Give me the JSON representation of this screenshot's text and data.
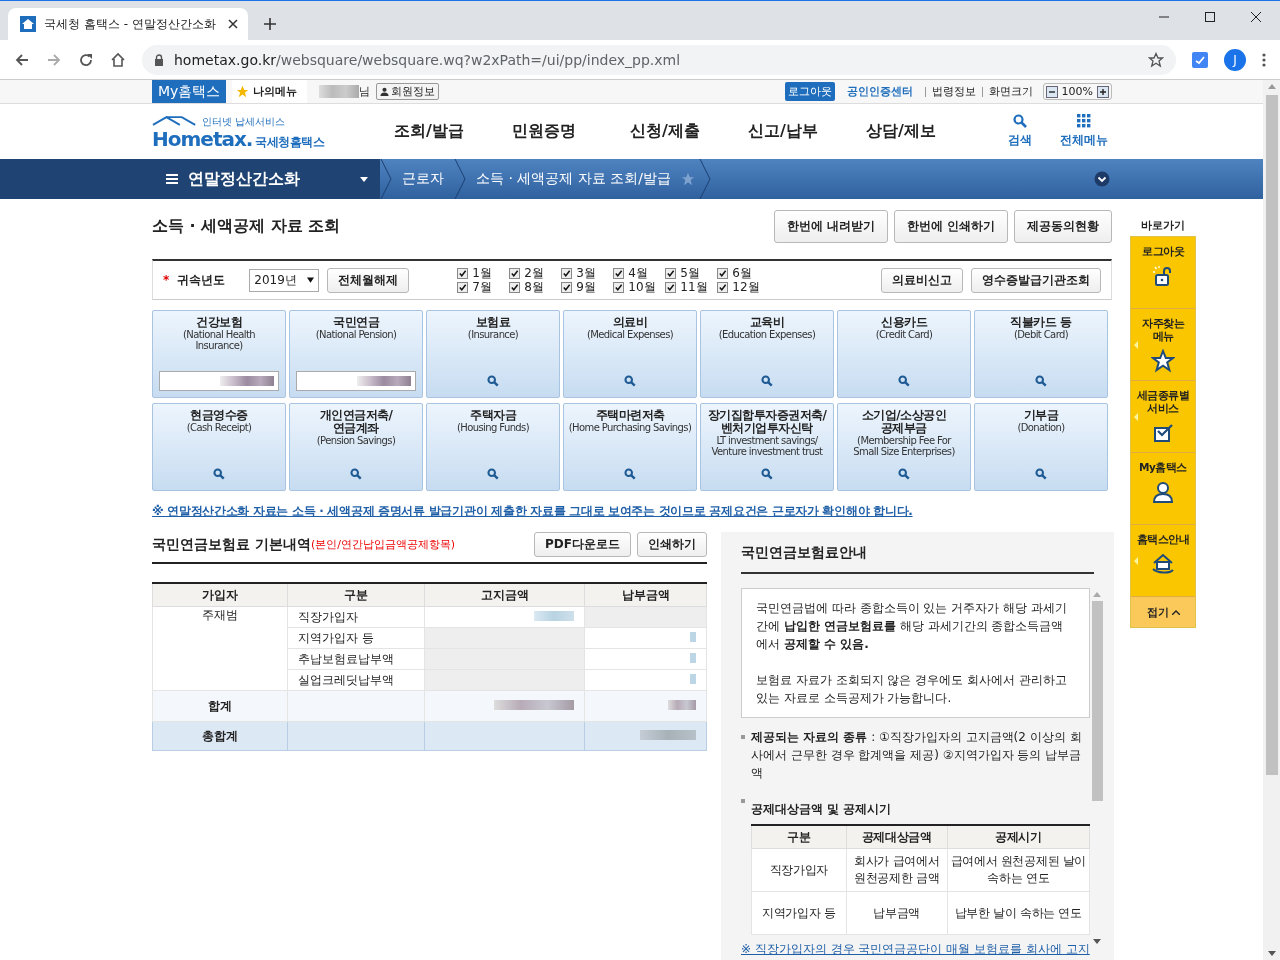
{
  "browser": {
    "tab_title": "국세청 홈택스 - 연말정산간소화",
    "url_host": "hometax.go.kr",
    "url_path": "/websquare/websquare.wq?w2xPath=/ui/pp/index_pp.xml",
    "profile_initial": "J"
  },
  "top_bar": {
    "my_hometax": "My홈택스",
    "my_menu": "나의메뉴",
    "user_suffix": "님",
    "member_info": "회원정보",
    "logout": "로그아웃",
    "cert_center": "공인인증센터",
    "law_info": "법령정보",
    "zoom_label": "화면크기",
    "zoom_value": "100%"
  },
  "header": {
    "logo_tagline": "인터넷 납세서비스",
    "logo_word": "Hometax.",
    "logo_name": "국세청홈택스",
    "nav": [
      "조회/발급",
      "민원증명",
      "신청/제출",
      "신고/납부",
      "상담/제보"
    ],
    "search": "검색",
    "all_menu": "전체메뉴"
  },
  "breadcrumb": {
    "menu": "연말정산간소화",
    "crumbs": [
      "근로자",
      "소득 · 세액공제 자료 조회/발급"
    ]
  },
  "page_title": "소득 · 세액공제 자료 조회",
  "title_buttons": [
    "한번에 내려받기",
    "한번에 인쇄하기",
    "제공동의현황"
  ],
  "filter": {
    "required_mark": "*",
    "label": "귀속년도",
    "year": "2019년",
    "clear_months": "전체월해제",
    "months": [
      {
        "label": "1월",
        "checked": true
      },
      {
        "label": "2월",
        "checked": true
      },
      {
        "label": "3월",
        "checked": true
      },
      {
        "label": "4월",
        "checked": true
      },
      {
        "label": "5월",
        "checked": true
      },
      {
        "label": "6월",
        "checked": true
      },
      {
        "label": "7월",
        "checked": true
      },
      {
        "label": "8월",
        "checked": true
      },
      {
        "label": "9월",
        "checked": true
      },
      {
        "label": "10월",
        "checked": true
      },
      {
        "label": "11월",
        "checked": true
      },
      {
        "label": "12월",
        "checked": true
      }
    ],
    "buttons": [
      "의료비신고",
      "영수증발급기관조회"
    ]
  },
  "tiles": [
    {
      "title": "건강보험",
      "subtitle": "(National Health\nInsurance)",
      "kind": "amount"
    },
    {
      "title": "국민연금",
      "subtitle": "(National Pension)",
      "kind": "amount"
    },
    {
      "title": "보험료",
      "subtitle": "(Insurance)",
      "kind": "search"
    },
    {
      "title": "의료비",
      "subtitle": "(Medical Expenses)",
      "kind": "search"
    },
    {
      "title": "교육비",
      "subtitle": "(Education Expenses)",
      "kind": "search"
    },
    {
      "title": "신용카드",
      "subtitle": "(Credit Card)",
      "kind": "search"
    },
    {
      "title": "직불카드 등",
      "subtitle": "(Debit Card)",
      "kind": "search"
    },
    {
      "title": "현금영수증",
      "subtitle": "(Cash Receipt)",
      "kind": "search"
    },
    {
      "title": "개인연금저축/\n연금계좌",
      "subtitle": "(Pension Savings)",
      "kind": "search"
    },
    {
      "title": "주택자금",
      "subtitle": "(Housing Funds)",
      "kind": "search"
    },
    {
      "title": "주택마련저축",
      "subtitle": "(Home Purchasing Savings)",
      "kind": "search"
    },
    {
      "title": "장기집합투자증권저축/\n벤처기업투자신탁",
      "subtitle": "LT investment savings/\nVenture investment trust",
      "kind": "search"
    },
    {
      "title": "소기업/소상공인\n공제부금",
      "subtitle": "(Membership Fee For\nSmall Size Enterprises)",
      "kind": "search"
    },
    {
      "title": "기부금",
      "subtitle": "(Donation)",
      "kind": "search"
    }
  ],
  "notice": "※ 연말정산간소화 자료는 소득 · 세액공제 증명서류 발급기관이 제출한 자료를 그대로 보여주는 것이므로 공제요건은 근로자가 확인해야 합니다.",
  "pension": {
    "title": "국민연금보험료 기본내역",
    "note": "(본인/연간납입금액공제항목)",
    "buttons": [
      "PDF다운로드",
      "인쇄하기"
    ],
    "columns": [
      "가입자",
      "구분",
      "고지금액",
      "납부금액"
    ],
    "subscriber": "주재범",
    "rows": [
      "직장가입자",
      "지역가입자 등",
      "추납보험료납부액",
      "실업크레딧납부액"
    ],
    "sum_label": "합계",
    "total_label": "총합계"
  },
  "guide": {
    "title": "국민연금보험료안내",
    "paragraphs": [
      "국민연금법에 따라 종합소득이 있는 거주자가 해당 과세기간에 **납입한 연금보험료를** 해당 과세기간의 종합소득금액에서 **공제할 수 있음.**",
      "보험료 자료가 조회되지 않은 경우에도 회사에서 관리하고 있는 자료로 소득공제가 가능합니다."
    ],
    "data_types": "**제공되는 자료의 종류** : ①직장가입자의 고지금액(2 이상의 회사에서 근무한 경우 합계액을 제공) ②지역가입자 등의 납부금액",
    "deduction_heading": "공제대상금액 및 공제시기",
    "columns": [
      "구분",
      "공제대상금액",
      "공제시기"
    ],
    "rows": [
      [
        "직장가입자",
        "회사가 급여에서 원천공제한 금액",
        "급여에서 원천공제된 날이 속하는 연도"
      ],
      [
        "지역가입자 등",
        "납부금액",
        "납부한 날이 속하는 연도"
      ]
    ],
    "footnote": "※ 직장가입자의 경우 국민연금공단이 매월 보험료를 회사에 고지"
  },
  "quick_menu": {
    "title": "바로가기",
    "items": [
      {
        "label": "로그아웃",
        "kind": "lock",
        "has_submenu": false
      },
      {
        "label": "자주찾는\n메뉴",
        "kind": "star",
        "has_submenu": true
      },
      {
        "label": "세금종류별\n서비스",
        "kind": "check",
        "has_submenu": true
      },
      {
        "label": "My홈택스",
        "kind": "person",
        "has_submenu": false
      },
      {
        "label": "홈택스안내",
        "kind": "home",
        "has_submenu": true
      }
    ],
    "collapse": "접기"
  }
}
